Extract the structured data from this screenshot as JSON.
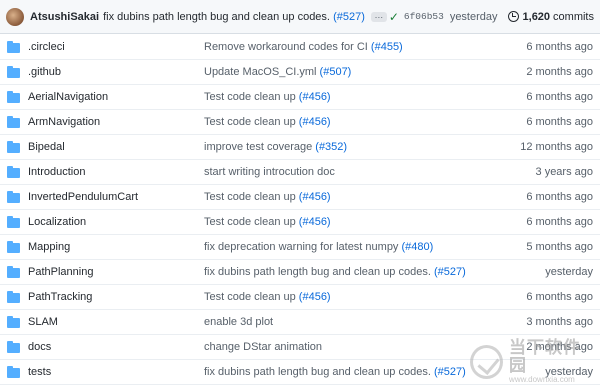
{
  "latest_commit": {
    "author": "AtsushiSakai",
    "message": "fix dubins path length bug and clean up codes.",
    "pr": "(#527)",
    "ellipsis": "…",
    "sha": "6f06b53",
    "when": "yesterday",
    "commits_count": "1,620",
    "commits_label": "commits",
    "status_color": "#1a7f37"
  },
  "files": [
    {
      "name": ".circleci",
      "msg": "Remove workaround codes for CI",
      "pr": "(#455)",
      "age": "6 months ago"
    },
    {
      "name": ".github",
      "msg": "Update MacOS_CI.yml",
      "pr": "(#507)",
      "age": "2 months ago"
    },
    {
      "name": "AerialNavigation",
      "msg": "Test code clean up",
      "pr": "(#456)",
      "age": "6 months ago"
    },
    {
      "name": "ArmNavigation",
      "msg": "Test code clean up",
      "pr": "(#456)",
      "age": "6 months ago"
    },
    {
      "name": "Bipedal",
      "msg": "improve test coverage",
      "pr": "(#352)",
      "age": "12 months ago"
    },
    {
      "name": "Introduction",
      "msg": "start writing introcution doc",
      "pr": "",
      "age": "3 years ago"
    },
    {
      "name": "InvertedPendulumCart",
      "msg": "Test code clean up",
      "pr": "(#456)",
      "age": "6 months ago"
    },
    {
      "name": "Localization",
      "msg": "Test code clean up",
      "pr": "(#456)",
      "age": "6 months ago"
    },
    {
      "name": "Mapping",
      "msg": "fix deprecation warning for latest numpy",
      "pr": "(#480)",
      "age": "5 months ago"
    },
    {
      "name": "PathPlanning",
      "msg": "fix dubins path length bug and clean up codes.",
      "pr": "(#527)",
      "age": "yesterday"
    },
    {
      "name": "PathTracking",
      "msg": "Test code clean up",
      "pr": "(#456)",
      "age": "6 months ago"
    },
    {
      "name": "SLAM",
      "msg": "enable 3d plot",
      "pr": "",
      "age": "3 months ago"
    },
    {
      "name": "docs",
      "msg": "change DStar animation",
      "pr": "",
      "age": "2 months ago"
    },
    {
      "name": "tests",
      "msg": "fix dubins path length bug and clean up codes.",
      "pr": "(#527)",
      "age": "yesterday"
    }
  ],
  "icons": {
    "folder": "folder-icon",
    "history": "history-icon",
    "check": "check-icon"
  },
  "colors": {
    "folder": "#54aeff",
    "link": "#0969da"
  },
  "watermark": {
    "cn": "当下软件园",
    "url": "www.downxia.com"
  }
}
